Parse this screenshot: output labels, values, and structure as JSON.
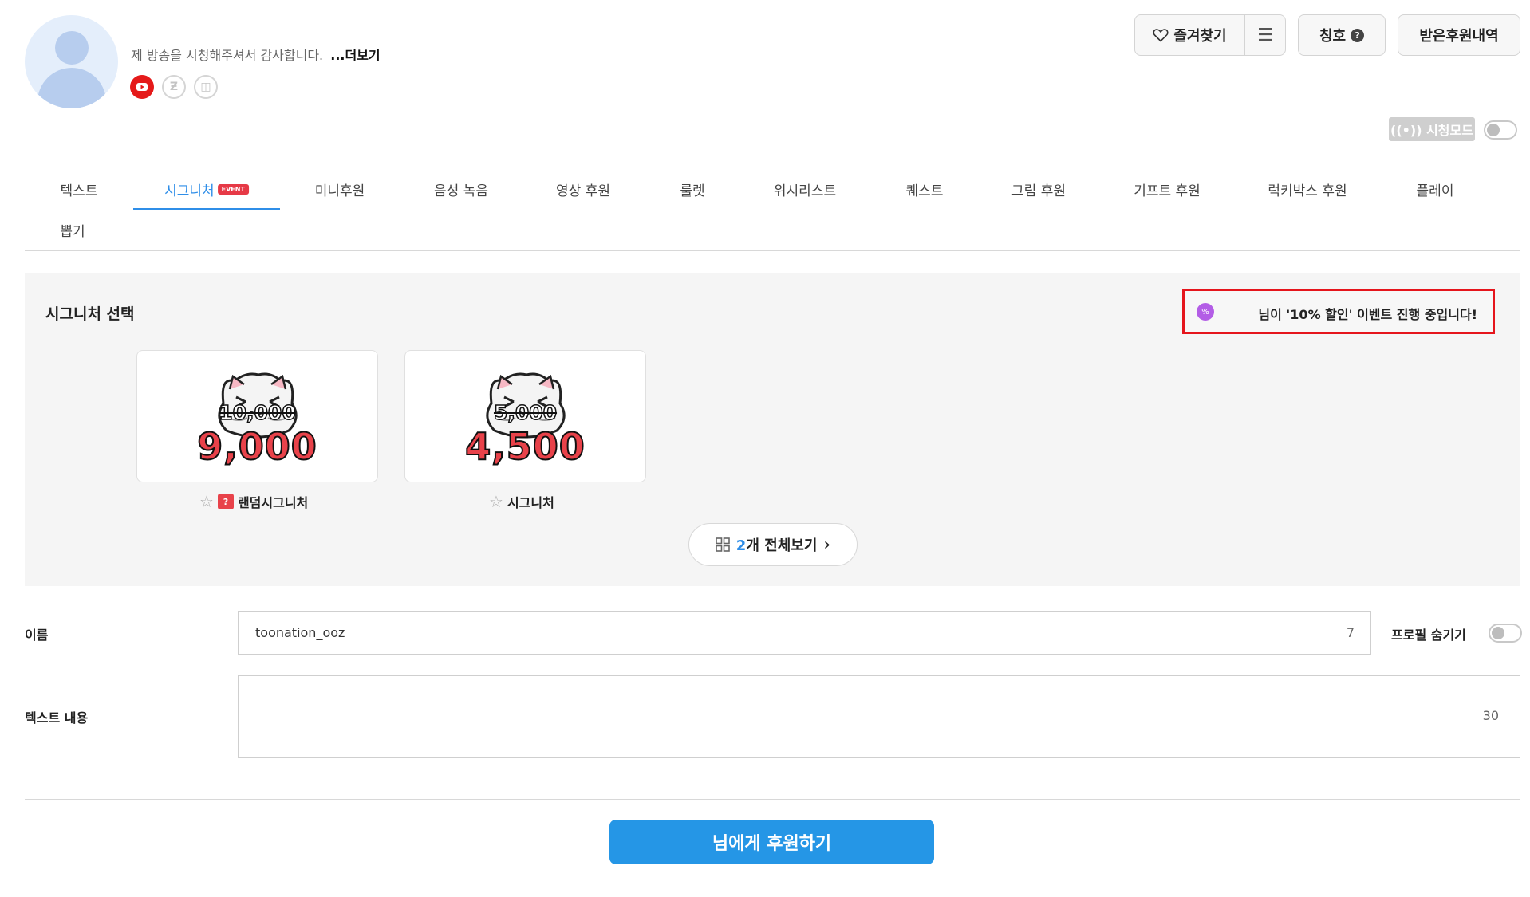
{
  "profile": {
    "intro": "제 방송을 시청해주셔서 감사합니다.",
    "more_label": "...더보기",
    "social_icons": [
      "youtube-icon",
      "zep-icon",
      "chat-icon"
    ],
    "social_glyphs": [
      "▶",
      "Ƶ",
      "◫"
    ]
  },
  "header": {
    "favorite_label": "즐겨찾기",
    "menu_glyph": "☰",
    "title_label": "칭호",
    "title_help": "?",
    "history_label": "받은후원내역",
    "watch_mode_label": "((•)) 시청모드"
  },
  "tabs": [
    {
      "label": "텍스트",
      "active": false
    },
    {
      "label": "시그니처",
      "active": true,
      "badge": "EVENT"
    },
    {
      "label": "미니후원",
      "active": false
    },
    {
      "label": "음성 녹음",
      "active": false
    },
    {
      "label": "영상 후원",
      "active": false
    },
    {
      "label": "룰렛",
      "active": false
    },
    {
      "label": "위시리스트",
      "active": false
    },
    {
      "label": "퀘스트",
      "active": false
    },
    {
      "label": "그림 후원",
      "active": false
    },
    {
      "label": "기프트 후원",
      "active": false
    },
    {
      "label": "럭키박스 후원",
      "active": false
    },
    {
      "label": "플레이",
      "active": false
    },
    {
      "label": "뽑기",
      "active": false
    }
  ],
  "signature": {
    "section_title": "시그니처 선택",
    "event_badge": "%",
    "event_text": "님이 '10% 할인' 이벤트 진행 중입니다!",
    "cards": [
      {
        "old_price": "10,000",
        "new_price": "9,000",
        "name": "랜덤시그니처",
        "random_badge": "?"
      },
      {
        "old_price": "5,000",
        "new_price": "4,500",
        "name": "시그니처"
      }
    ],
    "star_glyph": "☆",
    "view_all_count": "2",
    "view_all_label": "개 전체보기",
    "view_all_chevron": "›"
  },
  "form": {
    "name_label": "이름",
    "name_value": "toonation_ooz",
    "name_count": "7",
    "hide_profile_label": "프로필 숨기기",
    "text_label": "텍스트 내용",
    "text_count": "30"
  },
  "submit_label": "님에게 후원하기",
  "colors": {
    "accent": "#2f8ee8",
    "button": "#2596e6",
    "event_border": "#e5151c",
    "price": "#e8424a"
  }
}
